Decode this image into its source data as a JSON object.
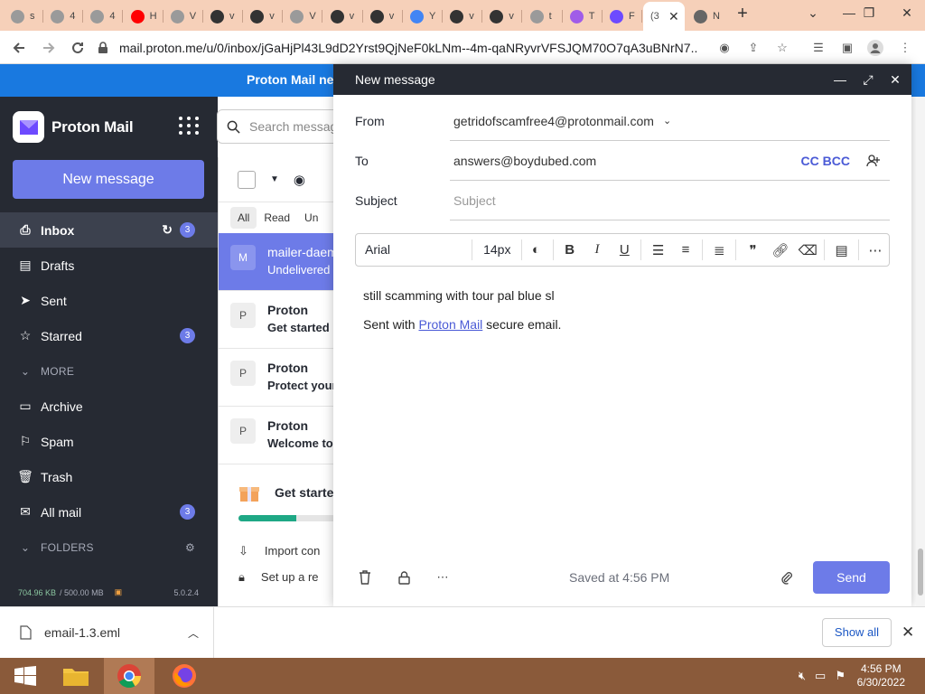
{
  "browser": {
    "tabs": [
      {
        "letter": "s",
        "color": "#9a9a9a"
      },
      {
        "letter": "4",
        "color": "#9a9a9a"
      },
      {
        "letter": "4",
        "color": "#9a9a9a"
      },
      {
        "letter": "H",
        "color": "#ff0000"
      },
      {
        "letter": "V",
        "color": "#9a9a9a"
      },
      {
        "letter": "v",
        "color": "#333333"
      },
      {
        "letter": "v",
        "color": "#333333"
      },
      {
        "letter": "V",
        "color": "#9a9a9a"
      },
      {
        "letter": "v",
        "color": "#333333"
      },
      {
        "letter": "v",
        "color": "#333333"
      },
      {
        "letter": "Y",
        "color": "#4285f4"
      },
      {
        "letter": "v",
        "color": "#333333"
      },
      {
        "letter": "v",
        "color": "#333333"
      },
      {
        "letter": "t",
        "color": "#9a9a9a"
      },
      {
        "letter": "T",
        "color": "#a05ce8"
      },
      {
        "letter": "F",
        "color": "#6d4aff"
      }
    ],
    "active_tab_title": "(3",
    "next_tab_title": "N",
    "new_tab": "+",
    "url": "mail.proton.me/u/0/inbox/jGaHjPl43L9dD2Yrst9QjNeF0kLNm--4m-qaNRyvrVFSJQM70O7qA3uBNrN7..."
  },
  "banner": {
    "text": "Proton Mail ne"
  },
  "sidebar": {
    "brand": "Proton Mail",
    "new_message": "New message",
    "items": [
      {
        "label": "Inbox",
        "icon": "inbox-icon",
        "badge": "3"
      },
      {
        "label": "Drafts",
        "icon": "drafts-icon",
        "badge": ""
      },
      {
        "label": "Sent",
        "icon": "sent-icon",
        "badge": ""
      },
      {
        "label": "Starred",
        "icon": "star-icon",
        "badge": "3"
      },
      {
        "label": "MORE",
        "icon": "chevron-down-icon",
        "badge": ""
      },
      {
        "label": "Archive",
        "icon": "archive-icon",
        "badge": ""
      },
      {
        "label": "Spam",
        "icon": "spam-icon",
        "badge": ""
      },
      {
        "label": "Trash",
        "icon": "trash-icon",
        "badge": ""
      },
      {
        "label": "All mail",
        "icon": "all-mail-icon",
        "badge": "3"
      },
      {
        "label": "FOLDERS",
        "icon": "chevron-down-icon",
        "badge": ""
      }
    ],
    "storage_used": "704.96 KB",
    "storage_total": "/ 500.00 MB",
    "version": "5.0.2.4"
  },
  "search": {
    "placeholder": "Search messag"
  },
  "list": {
    "filters": [
      "All",
      "Read",
      "Un"
    ],
    "messages": [
      {
        "avatar": "M",
        "from": "mailer-daem",
        "subject": "Undelivered",
        "selected": true
      },
      {
        "avatar": "P",
        "from": "Proton",
        "subject": "Get started",
        "selected": false
      },
      {
        "avatar": "P",
        "from": "Proton",
        "subject": "Protect your",
        "selected": false
      },
      {
        "avatar": "P",
        "from": "Proton",
        "subject": "Welcome to",
        "selected": false
      }
    ],
    "get_started": "Get starte",
    "progress_fraction": 0.58,
    "tips": [
      "Import con",
      "Set up a re"
    ]
  },
  "composer": {
    "title": "New message",
    "from_label": "From",
    "from_value": "getridofscamfree4@protonmail.com",
    "to_label": "To",
    "to_value": "answers@boydubed.com",
    "cc_bcc": "CC BCC",
    "subject_label": "Subject",
    "subject_placeholder": "Subject",
    "font": "Arial",
    "font_size": "14px",
    "body_line1": "still scamming with tour pal blue sl",
    "body_sent_prefix": "Sent with ",
    "body_link": "Proton Mail",
    "body_sent_suffix": " secure email.",
    "saved": "Saved at 4:56 PM",
    "send": "Send"
  },
  "downloads": {
    "file": "email-1.3.eml",
    "show_all": "Show all"
  },
  "taskbar": {
    "time": "4:56 PM",
    "date": "6/30/2022"
  }
}
